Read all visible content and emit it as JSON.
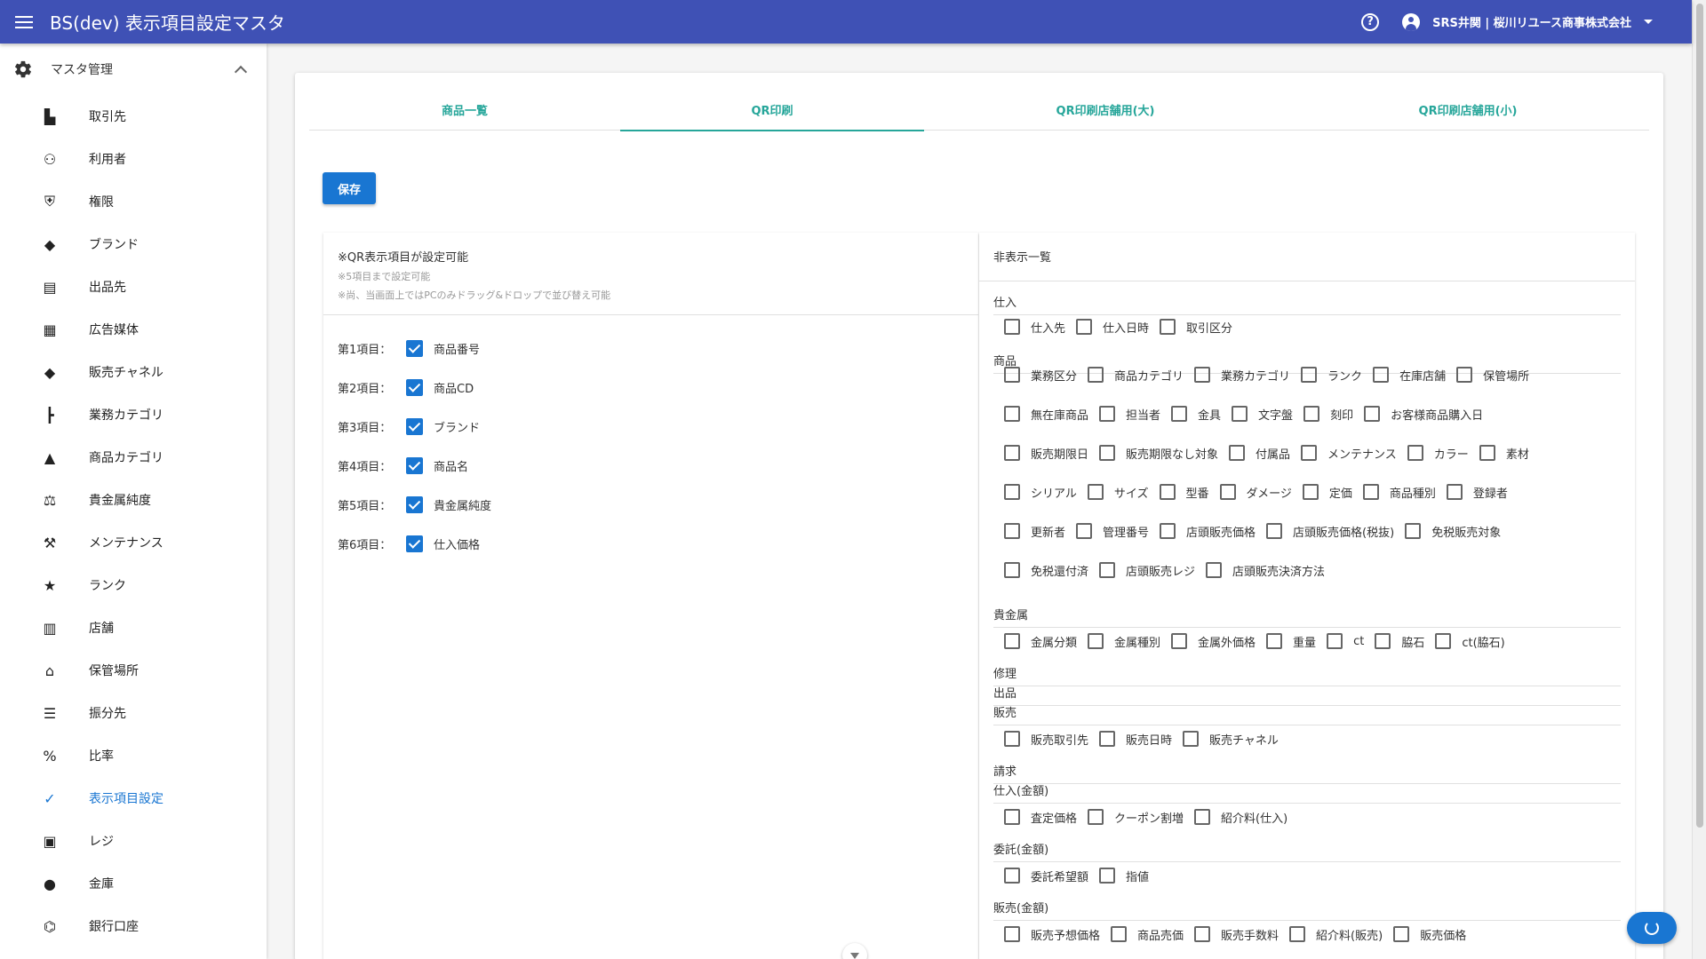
{
  "appbar": {
    "title": "BS(dev) 表示項目設定マスタ",
    "user": "SRS井関 | 桜川リユース商事株式会社"
  },
  "sidebar": {
    "group_label": "マスタ管理",
    "items": [
      {
        "label": "取引先",
        "icon": "building-icon"
      },
      {
        "label": "利用者",
        "icon": "group-icon"
      },
      {
        "label": "権限",
        "icon": "shield-icon"
      },
      {
        "label": "ブランド",
        "icon": "tag-icon"
      },
      {
        "label": "出品先",
        "icon": "archive-icon"
      },
      {
        "label": "広告媒体",
        "icon": "document-icon"
      },
      {
        "label": "販売チャネル",
        "icon": "tag-icon"
      },
      {
        "label": "業務カテゴリ",
        "icon": "tree-icon"
      },
      {
        "label": "商品カテゴリ",
        "icon": "shapes-icon"
      },
      {
        "label": "貴金属純度",
        "icon": "scale-icon"
      },
      {
        "label": "メンテナンス",
        "icon": "tools-icon"
      },
      {
        "label": "ランク",
        "icon": "star-icon"
      },
      {
        "label": "店舗",
        "icon": "store-icon"
      },
      {
        "label": "保管場所",
        "icon": "warehouse-icon"
      },
      {
        "label": "振分先",
        "icon": "list-icon"
      },
      {
        "label": "比率",
        "icon": "percent-icon"
      },
      {
        "label": "表示項目設定",
        "icon": "checklist-icon",
        "active": true
      },
      {
        "label": "レジ",
        "icon": "register-icon"
      },
      {
        "label": "金庫",
        "icon": "piggy-bank-icon"
      },
      {
        "label": "銀行口座",
        "icon": "bank-icon"
      }
    ]
  },
  "tabs": [
    {
      "label": "商品一覧"
    },
    {
      "label": "QR印刷",
      "active": true
    },
    {
      "label": "QR印刷店舗用(大)"
    },
    {
      "label": "QR印刷店舗用(小)"
    }
  ],
  "save_label": "保存",
  "left_panel": {
    "title": "※QR表示項目が設定可能",
    "note1": "※5項目まで設定可能",
    "note2": "※尚、当画面上ではPCのみドラッグ&ドロップで並び替え可能",
    "rows": [
      {
        "key": "第1項目：",
        "value": "商品番号"
      },
      {
        "key": "第2項目：",
        "value": "商品CD"
      },
      {
        "key": "第3項目：",
        "value": "ブランド"
      },
      {
        "key": "第4項目：",
        "value": "商品名"
      },
      {
        "key": "第5項目：",
        "value": "貴金属純度"
      },
      {
        "key": "第6項目：",
        "value": "仕入価格"
      }
    ]
  },
  "right_panel": {
    "title": "非表示一覧",
    "sections": {
      "s0": "仕入",
      "s1": "商品",
      "s2": "貴金属",
      "s3": "修理",
      "s4": "出品",
      "s5": "販売",
      "s6": "請求",
      "s7": "仕入(金額)",
      "s8": "委託(金額)",
      "s9": "販売(金額)"
    },
    "rows": [
      [
        "仕入先",
        "仕入日時",
        "取引区分"
      ],
      [
        "業務区分",
        "商品カテゴリ",
        "業務カテゴリ",
        "ランク",
        "在庫店舗",
        "保管場所"
      ],
      [
        "無在庫商品",
        "担当者",
        "金具",
        "文字盤",
        "刻印",
        "お客様商品購入日"
      ],
      [
        "販売期限日",
        "販売期限なし対象",
        "付属品",
        "メンテナンス",
        "カラー",
        "素材"
      ],
      [
        "シリアル",
        "サイズ",
        "型番",
        "ダメージ",
        "定価",
        "商品種別",
        "登録者"
      ],
      [
        "更新者",
        "管理番号",
        "店頭販売価格",
        "店頭販売価格(税抜)",
        "免税販売対象"
      ],
      [
        "免税還付済",
        "店頭販売レジ",
        "店頭販売決済方法"
      ],
      [
        "金属分類",
        "金属種別",
        "金属外価格",
        "重量",
        "ct",
        "脇石",
        "ct(脇石)"
      ],
      [
        "販売取引先",
        "販売日時",
        "販売チャネル"
      ],
      [
        "査定価格",
        "クーポン割増",
        "紹介料(仕入)"
      ],
      [
        "委託希望額",
        "指値"
      ],
      [
        "販売予想価格",
        "商品売価",
        "販売手数料",
        "紹介料(販売)",
        "販売価格"
      ]
    ]
  }
}
